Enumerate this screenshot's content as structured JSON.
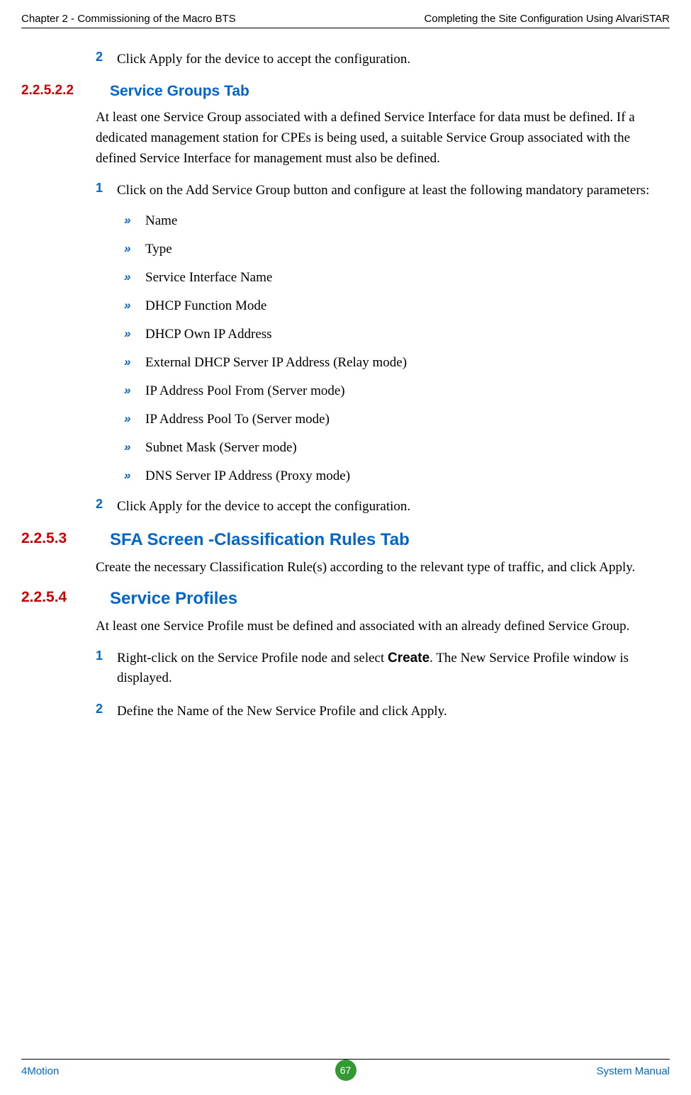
{
  "header": {
    "left": "Chapter 2 - Commissioning of the Macro BTS",
    "right": "Completing the Site Configuration Using AlvariSTAR"
  },
  "content": {
    "step_2_intro": {
      "number": "2",
      "text": "Click Apply for the device to accept the configuration."
    },
    "section_22522": {
      "number": "2.2.5.2.2",
      "title": "Service Groups Tab",
      "body": "At least one Service Group associated with a defined Service Interface for data must be defined. If a dedicated management station for CPEs is being used, a suitable Service Group associated with the defined Service Interface for management must also be defined.",
      "step_1": {
        "number": "1",
        "text": "Click on the Add Service Group button and configure at least the following mandatory parameters:"
      },
      "bullets": {
        "b1": "Name",
        "b2": "Type",
        "b3": "Service Interface Name",
        "b4": "DHCP Function Mode",
        "b5": "DHCP Own IP Address",
        "b6": "External DHCP Server IP Address (Relay mode)",
        "b7": "IP Address Pool From (Server mode)",
        "b8": "IP Address Pool To (Server mode)",
        "b9": "Subnet Mask (Server mode)",
        "b10": "DNS Server IP Address (Proxy mode)"
      },
      "step_2": {
        "number": "2",
        "text": "Click Apply for the device to accept the configuration."
      }
    },
    "section_2253": {
      "number": "2.2.5.3",
      "title": "SFA Screen -Classification Rules Tab",
      "body": "Create the necessary Classification Rule(s) according to the relevant type of traffic, and click Apply."
    },
    "section_2254": {
      "number": "2.2.5.4",
      "title": "Service Profiles",
      "body": "At least one Service Profile must be defined and associated with an already defined Service Group.",
      "step_1": {
        "number": "1",
        "text_before": "Right-click on the Service Profile node and select ",
        "bold": "Create",
        "text_after": ". The New Service Profile window is displayed."
      },
      "step_2": {
        "number": "2",
        "text": "Define the Name of the New Service Profile and click Apply."
      }
    }
  },
  "bullet_marker": "»",
  "footer": {
    "left": "4Motion",
    "page": "67",
    "right": "System Manual"
  }
}
